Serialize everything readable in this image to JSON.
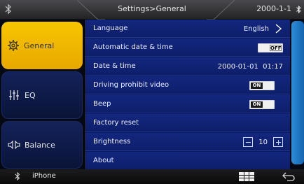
{
  "topbar": {
    "title": "Settings>General",
    "date": "2000-1-1",
    "left_icon": "bluetooth-icon",
    "right_icon": "bluetooth-icon"
  },
  "nav": [
    {
      "label": "General",
      "icon": "gear-icon",
      "active": true
    },
    {
      "label": "EQ",
      "icon": "equalizer-icon",
      "active": false
    },
    {
      "label": "Balance",
      "icon": "speaker-balance-icon",
      "active": false
    }
  ],
  "settings": {
    "language": {
      "label": "Language",
      "value": "English"
    },
    "auto_datetime": {
      "label": "Automatic date & time",
      "toggle": "OFF"
    },
    "datetime": {
      "label": "Date & time",
      "value": "2000-01-01  01:17"
    },
    "driving_prohibit_video": {
      "label": "Driving prohibit video",
      "toggle": "ON"
    },
    "beep": {
      "label": "Beep",
      "toggle": "ON"
    },
    "factory_reset": {
      "label": "Factory reset"
    },
    "brightness": {
      "label": "Brightness",
      "value": "10"
    },
    "about": {
      "label": "About"
    }
  },
  "bottombar": {
    "device_name": "iPhone"
  },
  "colors": {
    "active_tab": "#f0b800",
    "list_bg": "#0d1e6a",
    "accent_blue": "#1e7cc8"
  }
}
